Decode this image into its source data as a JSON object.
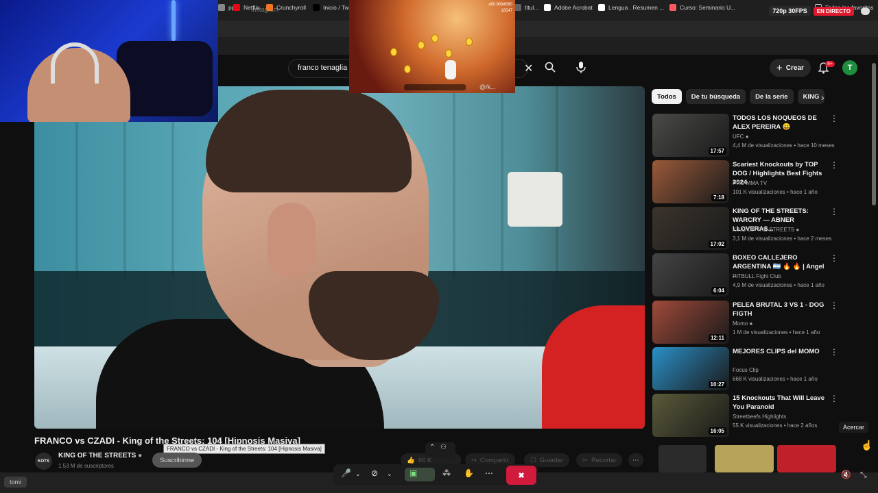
{
  "stream": {
    "resolution": "720p 30FPS",
    "live": "EN DIRECTO"
  },
  "browser": {
    "tab_title": "Instagram",
    "bookmarks": [
      {
        "label": "pp",
        "color": "#888888"
      },
      {
        "label": "Netflix",
        "color": "#e50914"
      },
      {
        "label": "Crunchyroll",
        "color": "#f47521"
      },
      {
        "label": "Inicio / Twit",
        "color": "#000000"
      },
      {
        "label": "titul...",
        "color": "#5f6368"
      },
      {
        "label": "Adobe Acrobat",
        "color": "#ffffff"
      },
      {
        "label": "Lengua . Resumen ...",
        "color": "#ffffff"
      },
      {
        "label": "Curso: Seminario U...",
        "color": "#ff5a5f"
      }
    ],
    "bookmarks_all": "Todos los favoritos"
  },
  "header": {
    "search_query": "franco tenaglia",
    "create_label": "Crear",
    "notif_count": "9+",
    "avatar_letter": "T"
  },
  "game": {
    "score": "9094580",
    "coins": "18547",
    "multiplier": "x60",
    "hud_text": "@/k..."
  },
  "video": {
    "title": "FRANCO vs CZADI - King of the Streets: 104 [Hipnosis Masiva]",
    "tooltip": "FRANCO vs CZADI - King of the Streets: 104 [Hipnosis Masiva]",
    "channel_logo": "KOTS",
    "channel": "KING OF THE STREETS",
    "subscribers": "1,53 M de suscriptores",
    "subscribe_label": "Suscribirme",
    "likes": "66 K",
    "share_label": "Compartir",
    "save_label": "Guardar",
    "clip_label": "Recortar"
  },
  "sidebar": {
    "chips": [
      "Todos",
      "De tu búsqueda",
      "De la serie",
      "KING"
    ],
    "recommendations": [
      {
        "title": "TODOS LOS NOQUEOS DE ALEX PEREIRA 😄",
        "channel": "UFC",
        "verified": true,
        "meta": "4,4 M de visualizaciones • hace 10 meses",
        "duration": "17:57",
        "thumb_color": "#4a4a48"
      },
      {
        "title": "Scariest Knockouts by TOP DOG / Highlights Best Fights 2024",
        "channel": "PRO MMA TV",
        "verified": false,
        "meta": "101 K visualizaciones • hace 1 año",
        "duration": "7:18",
        "thumb_color": "#9a5a3a"
      },
      {
        "title": "KING OF THE STREETS: WARCRY — ABNER LLOVERAS...",
        "channel": "KING OF THE STREETS",
        "verified": true,
        "meta": "3,1 M de visualizaciones • hace 2 meses",
        "duration": "17:02",
        "thumb_color": "#3a342c"
      },
      {
        "title": "BOXEO CALLEJERO ARGENTINA 🇦🇷 🔥 🔥 | Angel ...",
        "channel": "PITBULL Fight Club",
        "verified": false,
        "meta": "4,9 M de visualizaciones • hace 1 año",
        "duration": "6:04",
        "thumb_color": "#444444"
      },
      {
        "title": "PELEA BRUTAL 3 VS 1 - DOG FIGTH",
        "channel": "Momo",
        "verified": true,
        "meta": "1 M de visualizaciones • hace 1 año",
        "duration": "12:11",
        "thumb_color": "#a04a3a"
      },
      {
        "title": "MEJORES CLIPS del MOMO",
        "channel": "Focus Clip",
        "verified": false,
        "meta": "668 K visualizaciones • hace 1 año",
        "duration": "10:27",
        "thumb_color": "#2a90c8"
      },
      {
        "title": "15 Knockouts That Will Leave You Paranoid",
        "channel": "Streetbeefs Highlights",
        "verified": false,
        "meta": "55 K visualizaciones • hace 2 años",
        "duration": "16:05",
        "thumb_color": "#5a5a3a"
      }
    ]
  },
  "overlay": {
    "zoom_tooltip": "Acercar",
    "taskbar_user": "tomi"
  }
}
